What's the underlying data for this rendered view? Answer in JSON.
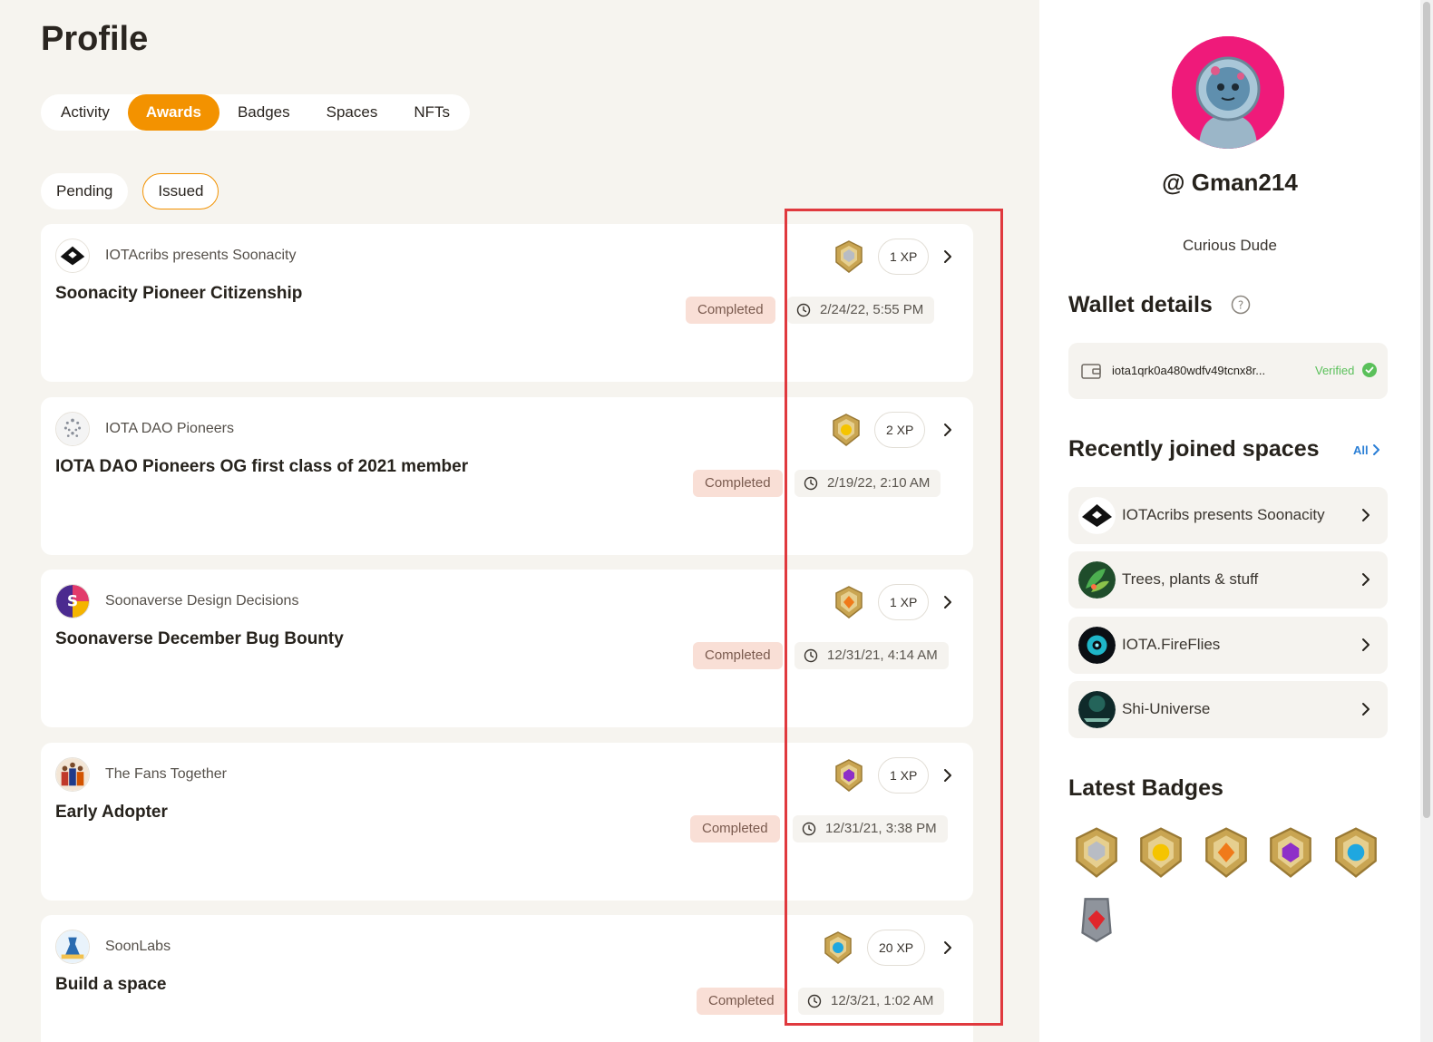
{
  "page_title": "Profile",
  "tabs": [
    {
      "label": "Activity"
    },
    {
      "label": "Awards",
      "active": true
    },
    {
      "label": "Badges"
    },
    {
      "label": "Spaces"
    },
    {
      "label": "NFTs"
    }
  ],
  "subtabs": [
    {
      "label": "Pending"
    },
    {
      "label": "Issued",
      "active": true
    }
  ],
  "awards": [
    {
      "space": "IOTAcribs presents Soonacity",
      "title": "Soonacity Pioneer Citizenship",
      "xp": "1 XP",
      "status": "Completed",
      "date": "2/24/22, 5:55 PM",
      "badge_icon": "silver-badge-icon"
    },
    {
      "space": "IOTA DAO Pioneers",
      "title": "IOTA DAO Pioneers OG first class of 2021 member",
      "xp": "2 XP",
      "status": "Completed",
      "date": "2/19/22, 2:10 AM",
      "badge_icon": "yellow-gem-badge-icon"
    },
    {
      "space": "Soonaverse Design Decisions",
      "title": "Soonaverse December Bug Bounty",
      "xp": "1 XP",
      "status": "Completed",
      "date": "12/31/21, 4:14 AM",
      "badge_icon": "orange-gem-badge-icon"
    },
    {
      "space": "The Fans Together",
      "title": "Early Adopter",
      "xp": "1 XP",
      "status": "Completed",
      "date": "12/31/21, 3:38 PM",
      "badge_icon": "purple-gem-badge-icon"
    },
    {
      "space": "SoonLabs",
      "title": "Build a space",
      "xp": "20 XP",
      "status": "Completed",
      "date": "12/3/21, 1:02 AM",
      "badge_icon": "blue-gem-badge-icon"
    }
  ],
  "profile": {
    "username": "@ Gman214",
    "bio": "Curious Dude"
  },
  "wallet": {
    "title": "Wallet details",
    "address": "iota1qrk0a480wdfv49tcnx8r...",
    "verified_label": "Verified"
  },
  "recent_spaces": {
    "title": "Recently joined spaces",
    "all_label": "All",
    "items": [
      {
        "name": "IOTAcribs presents Soonacity"
      },
      {
        "name": "Trees, plants & stuff"
      },
      {
        "name": "IOTA.FireFlies"
      },
      {
        "name": "Shi-Universe"
      }
    ]
  },
  "latest_badges": {
    "title": "Latest Badges",
    "items": [
      "silver-badge-icon",
      "yellow-gem-badge-icon",
      "orange-gem-badge-icon",
      "purple-gem-badge-icon",
      "blue-gem-badge-icon",
      "red-gem-badge-icon"
    ]
  },
  "colors": {
    "accent": "#f39200",
    "status_bg": "#f9dfd6",
    "verified": "#5ac05a",
    "highlight": "#e0393e"
  }
}
